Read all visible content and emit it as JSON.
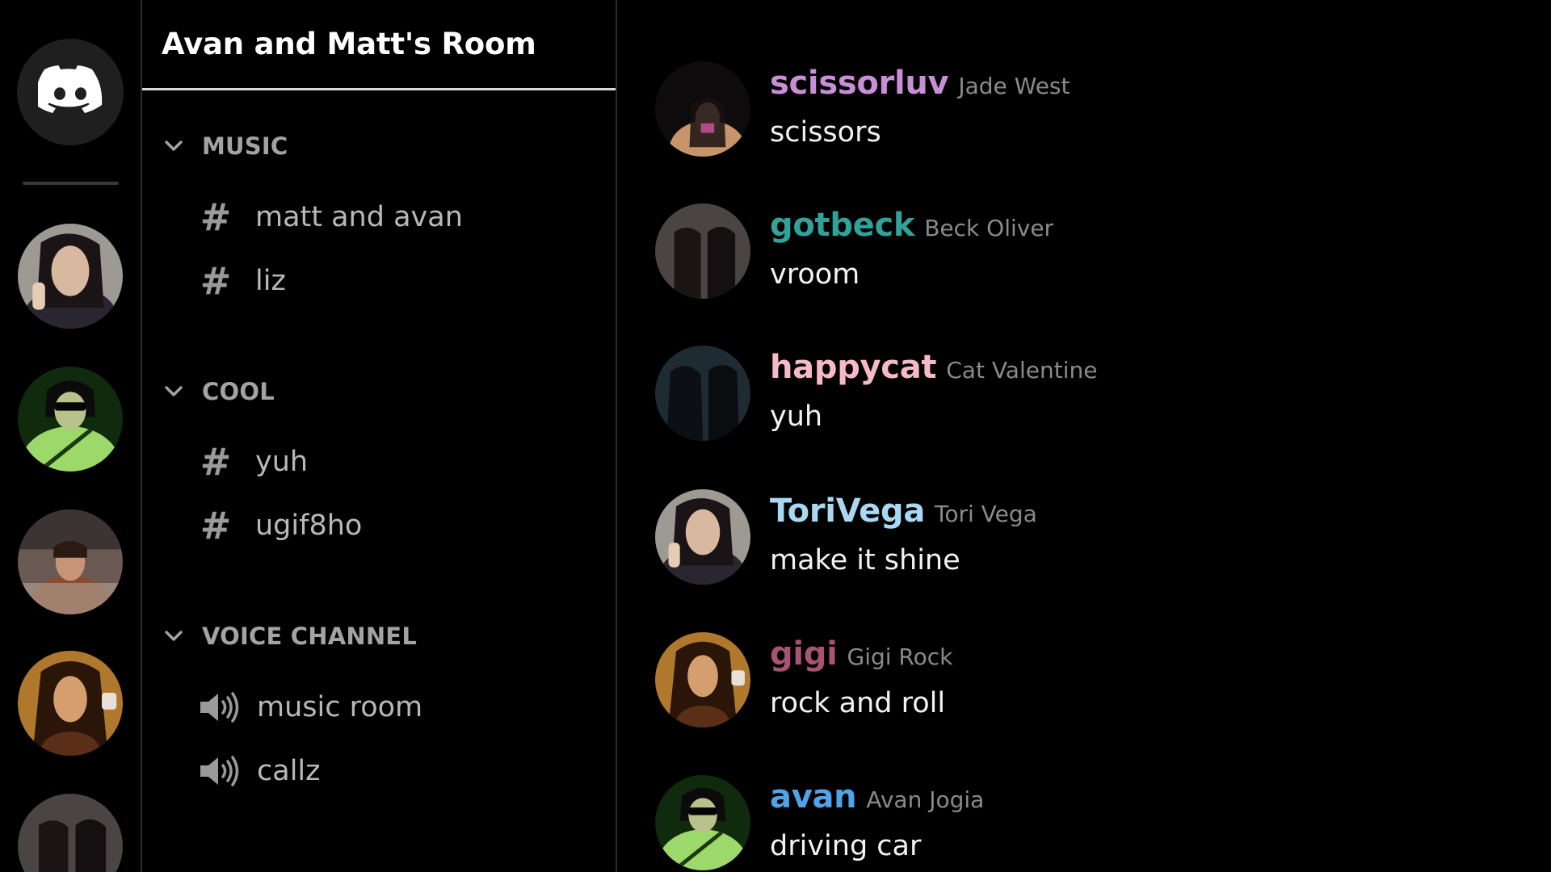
{
  "server": {
    "title": "Avan and Matt's Room"
  },
  "rail": {
    "home_icon": "discord-logo-icon",
    "servers": [
      {
        "name": "server-avatar-1"
      },
      {
        "name": "server-avatar-2"
      },
      {
        "name": "server-avatar-3"
      },
      {
        "name": "server-avatar-4"
      },
      {
        "name": "server-avatar-5"
      }
    ]
  },
  "categories": [
    {
      "label": "MUSIC",
      "channels": [
        {
          "type": "text",
          "label": "matt and avan"
        },
        {
          "type": "text",
          "label": "liz"
        }
      ]
    },
    {
      "label": "COOL",
      "channels": [
        {
          "type": "text",
          "label": "yuh"
        },
        {
          "type": "text",
          "label": "ugif8ho"
        }
      ]
    },
    {
      "label": "VOICE CHANNEL",
      "channels": [
        {
          "type": "voice",
          "label": "music room"
        },
        {
          "type": "voice",
          "label": "callz"
        }
      ]
    }
  ],
  "messages": [
    {
      "username": "scissorluv",
      "realname": "Jade West",
      "text": "scissors",
      "color": "#c98fd6"
    },
    {
      "username": "gotbeck",
      "realname": "Beck Oliver",
      "text": "vroom",
      "color": "#2fa39a"
    },
    {
      "username": "happycat",
      "realname": "Cat Valentine",
      "text": "yuh",
      "color": "#f6b9cc"
    },
    {
      "username": "ToriVega",
      "realname": "Tori Vega",
      "text": "make it shine",
      "color": "#a9d8f2"
    },
    {
      "username": "gigi",
      "realname": "Gigi Rock",
      "text": "rock and roll",
      "color": "#a85374"
    },
    {
      "username": "avan",
      "realname": "Avan Jogia",
      "text": "driving car",
      "color": "#4fa3e6"
    }
  ],
  "colors": {
    "background": "#000000",
    "panel_divider": "#2a2a2a",
    "header_underline": "#d9d9d9",
    "muted_text": "#a3a3a3",
    "realname_text": "#8a8a8a"
  }
}
